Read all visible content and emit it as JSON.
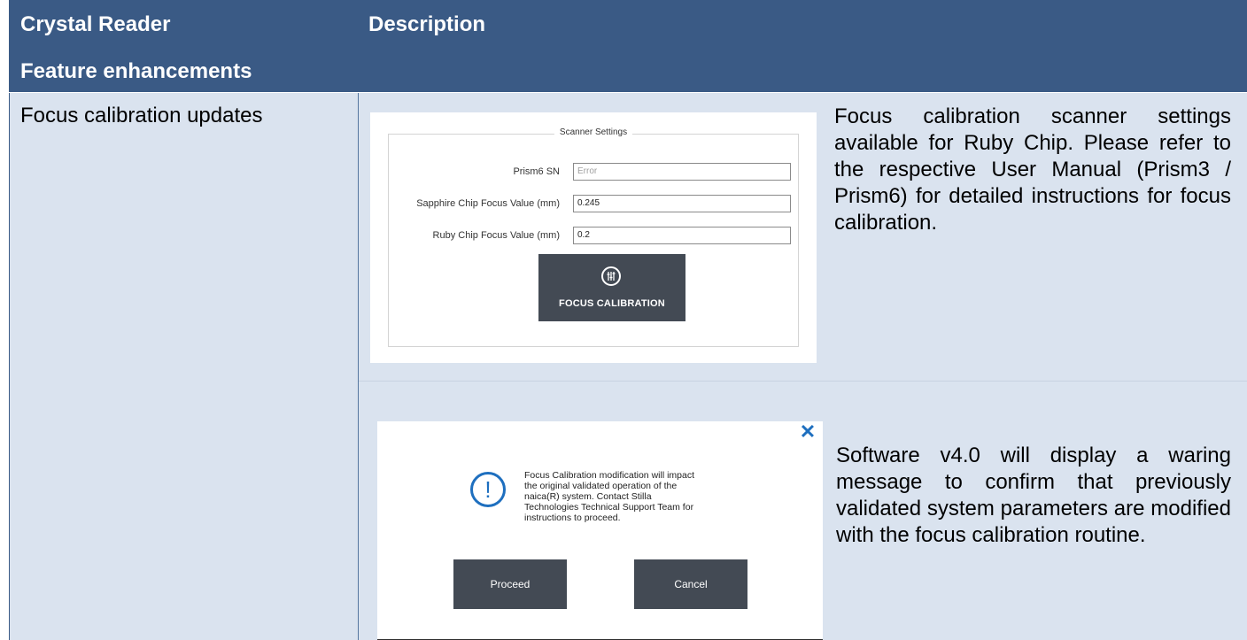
{
  "header": {
    "col1": "Crystal Reader",
    "col2": "Description",
    "section": "Feature enhancements"
  },
  "feature": {
    "label": "Focus calibration updates"
  },
  "scanner_settings": {
    "title": "Scanner Settings",
    "fields": [
      {
        "label": "Prism6 SN",
        "value": "Error"
      },
      {
        "label": "Sapphire Chip Focus Value (mm)",
        "value": "0.245"
      },
      {
        "label": "Ruby Chip Focus Value (mm)",
        "value": "0.2"
      }
    ],
    "button_label": "FOCUS CALIBRATION",
    "button_icon": "sliders-icon"
  },
  "description1": "Focus calibration scanner settings available for Ruby Chip. Please refer to the respective User Manual (Prism3 / Prism6) for detailed instructions for focus calibration.",
  "warning_dialog": {
    "close_icon": "close-icon",
    "warning_icon": "exclamation-icon",
    "message": "Focus Calibration modification will impact the original validated operation of the naica(R) system. Contact Stilla Technologies Technical Support Team for instructions to proceed.",
    "proceed_label": "Proceed",
    "cancel_label": "Cancel"
  },
  "description2": "Software v4.0 will display a waring message to confirm that previously validated system parameters are modified with the focus calibration routine.",
  "colors": {
    "header_bg": "#3a5a85",
    "body_bg": "#dae3ef",
    "button_bg": "#434a54",
    "accent_blue": "#1e6fbf"
  }
}
